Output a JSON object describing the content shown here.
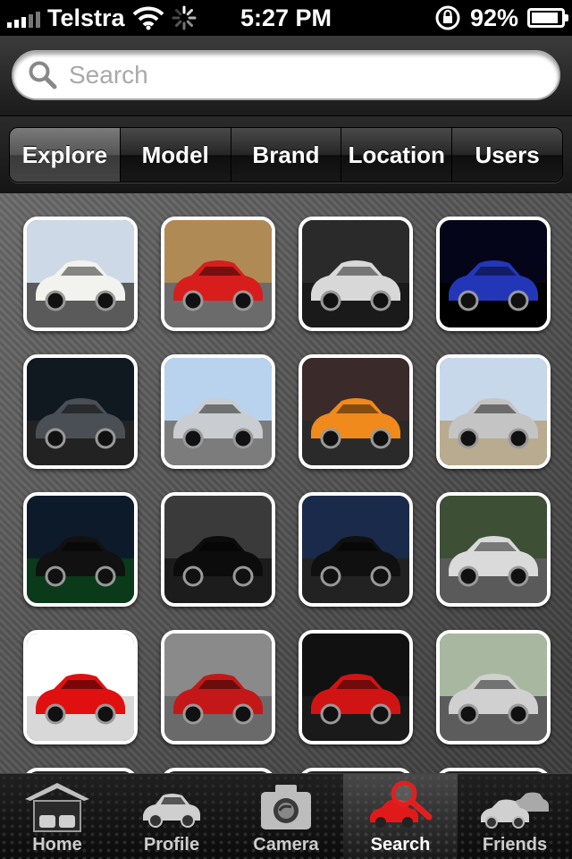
{
  "status_bar": {
    "carrier": "Telstra",
    "time": "5:27 PM",
    "battery": "92%",
    "battery_level": 0.92
  },
  "search": {
    "placeholder": "Search",
    "value": ""
  },
  "segments": [
    {
      "label": "Explore",
      "active": true
    },
    {
      "label": "Model",
      "active": false
    },
    {
      "label": "Brand",
      "active": false
    },
    {
      "label": "Location",
      "active": false
    },
    {
      "label": "Users",
      "active": false
    }
  ],
  "grid": {
    "thumbnails": [
      {
        "name": "white-vw-beetle",
        "sky": "#cdd9e6",
        "ground": "#5a5a5a",
        "car": "#f2f2ee"
      },
      {
        "name": "red-mustang",
        "sky": "#b08a55",
        "ground": "#6b6b6b",
        "car": "#d81d1d"
      },
      {
        "name": "silver-evo",
        "sky": "#2a2a2a",
        "ground": "#1a1a1a",
        "car": "#d8d8d8"
      },
      {
        "name": "blue-subaru-wrx",
        "sky": "#05051a",
        "ground": "#000000",
        "car": "#2436b8"
      },
      {
        "name": "chevrolet-interior",
        "sky": "#101820",
        "ground": "#222222",
        "car": "#4a4f55"
      },
      {
        "name": "silver-honda-civic",
        "sky": "#b9d3ef",
        "ground": "#7c7c7c",
        "car": "#c9ccd0"
      },
      {
        "name": "orange-veilside-rx7",
        "sky": "#3b2a2a",
        "ground": "#2a2a2a",
        "car": "#f08a1c"
      },
      {
        "name": "silver-mercedes-slr",
        "sky": "#c7d8ea",
        "ground": "#b8ab90",
        "car": "#c4c4c4"
      },
      {
        "name": "black-cruze-green-lights",
        "sky": "#0d1a2a",
        "ground": "#0a3a1a",
        "car": "#111111"
      },
      {
        "name": "black-sedan-garage",
        "sky": "#3a3a3a",
        "ground": "#1c1c1c",
        "car": "#0c0c0c"
      },
      {
        "name": "black-coupe-night",
        "sky": "#1a2a4a",
        "ground": "#222222",
        "car": "#101010"
      },
      {
        "name": "silver-civic-race",
        "sky": "#3d4f35",
        "ground": "#5a5a5a",
        "car": "#dadada"
      },
      {
        "name": "red-camaro",
        "sky": "#ffffff",
        "ground": "#d8d8d8",
        "car": "#e01010"
      },
      {
        "name": "red-viper",
        "sky": "#8a8a8a",
        "ground": "#6a6a6a",
        "car": "#c41818"
      },
      {
        "name": "red-mini-cooper",
        "sky": "#111111",
        "ground": "#1a1a1a",
        "car": "#d01414"
      },
      {
        "name": "silver-s2000",
        "sky": "#a8b8a0",
        "ground": "#5c5c5c",
        "car": "#d0d0d0"
      }
    ]
  },
  "tabs": [
    {
      "label": "Home",
      "icon": "garage-icon",
      "active": false
    },
    {
      "label": "Profile",
      "icon": "car-icon",
      "active": false
    },
    {
      "label": "Camera",
      "icon": "camera-icon",
      "active": false
    },
    {
      "label": "Search",
      "icon": "search-car-icon",
      "active": true
    },
    {
      "label": "Friends",
      "icon": "two-cars-icon",
      "active": false
    }
  ]
}
